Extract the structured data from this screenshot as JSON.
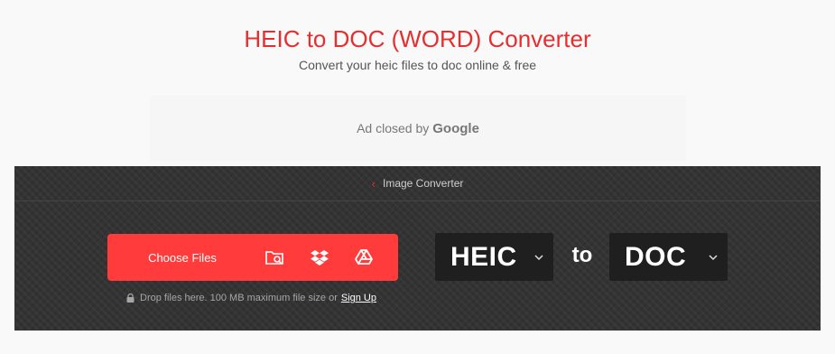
{
  "header": {
    "title": "HEIC to DOC (WORD) Converter",
    "subtitle": "Convert your heic files to doc online & free"
  },
  "ad": {
    "text": "Ad closed by",
    "brand": "Google"
  },
  "breadcrumb": {
    "label": "Image Converter"
  },
  "upload": {
    "choose_label": "Choose Files",
    "drop_note": "Drop files here. 100 MB maximum file size or",
    "signup_label": "Sign Up",
    "icons": [
      "folder-search-icon",
      "dropbox-icon",
      "google-drive-icon"
    ]
  },
  "conversion": {
    "from": "HEIC",
    "to_word": "to",
    "to": "DOC"
  },
  "colors": {
    "accent": "#ff3b3b",
    "title": "#e62e2e",
    "panel": "#333333",
    "select_bg": "#1f1f1f"
  }
}
